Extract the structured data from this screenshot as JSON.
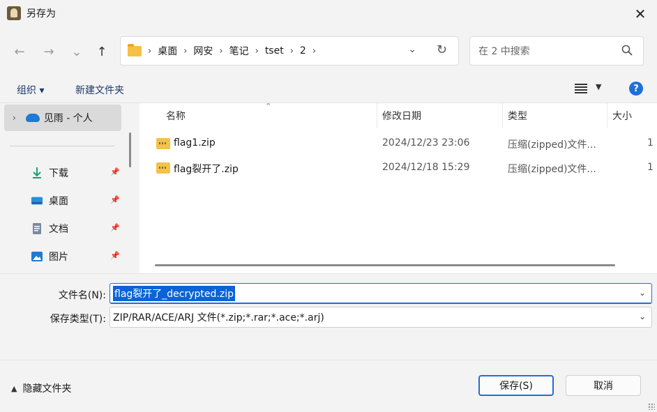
{
  "window": {
    "title": "另存为",
    "close_label": "✕"
  },
  "nav": {
    "back": "←",
    "forward": "→",
    "recent": "⌄",
    "up": "↑"
  },
  "address": {
    "crumbs": [
      "桌面",
      "网安",
      "笔记",
      "tset",
      "2"
    ],
    "sep": "›"
  },
  "search": {
    "placeholder": "在 2 中搜索"
  },
  "commands": {
    "organize": "组织 ▾",
    "new_folder": "新建文件夹"
  },
  "sidebar": {
    "top_item": "见雨 - 个人",
    "items": [
      {
        "label": "下载",
        "icon": "download-icon"
      },
      {
        "label": "桌面",
        "icon": "desktop-icon"
      },
      {
        "label": "文档",
        "icon": "document-icon"
      },
      {
        "label": "图片",
        "icon": "pictures-icon"
      }
    ]
  },
  "columns": {
    "name": "名称",
    "modified": "修改日期",
    "type": "类型",
    "size": "大小"
  },
  "files": [
    {
      "name": "flag1.zip",
      "modified": "2024/12/23 23:06",
      "type": "压缩(zipped)文件...",
      "size": "1"
    },
    {
      "name": "flag裂开了.zip",
      "modified": "2024/12/18 15:29",
      "type": "压缩(zipped)文件...",
      "size": "1"
    }
  ],
  "form": {
    "filename_label": "文件名(N):",
    "filename_value": "flag裂开了_decrypted.zip",
    "filetype_label": "保存类型(T):",
    "filetype_value": "ZIP/RAR/ACE/ARJ 文件(*.zip;*.rar;*.ace;*.arj)"
  },
  "footer": {
    "hide_folders": "隐藏文件夹",
    "save": "保存(S)",
    "cancel": "取消"
  },
  "colors": {
    "accent": "#1e6fd9",
    "folder": "#f6c044",
    "selection": "#0a64d6"
  }
}
